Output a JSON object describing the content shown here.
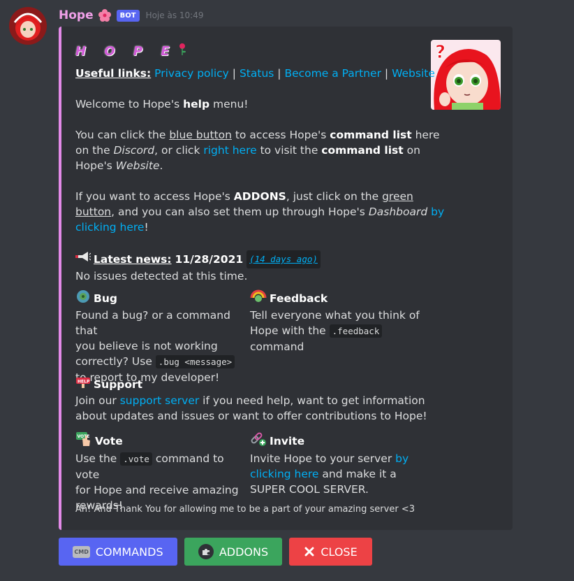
{
  "message": {
    "username": "Hope",
    "bot_tag": "BOT",
    "timestamp": "Hoje às 10:49"
  },
  "embed": {
    "title": "H O P E",
    "accent_color": "#e38ae8",
    "useful_links_label": "Useful links:",
    "links": [
      "Privacy policy",
      "Status",
      "Become a Partner",
      "Website"
    ],
    "separator": "|",
    "welcome_pre": "Welcome to Hope's ",
    "welcome_bold": "help",
    "welcome_post": " menu!",
    "p2_a": "You can click the ",
    "p2_blue_button": "blue button",
    "p2_b": " to access Hope's ",
    "p2_command_list": "command list",
    "p2_c": " here",
    "p2_d": "on the ",
    "p2_discord": "Discord",
    "p2_e": ", or click ",
    "p2_right_here": "right here",
    "p2_f": " to visit the ",
    "p2_command_list2": "command list",
    "p2_g": " on",
    "p2_h": "Hope's ",
    "p2_website": "Website",
    "p2_i": ".",
    "p3_a": "If you want to access Hope's ",
    "p3_addons": "ADDONS",
    "p3_b": ", just click on the ",
    "p3_green": "green",
    "p3_button": "button",
    "p3_c": ", and you can also set them up through Hope's ",
    "p3_dashboard": "Dashboard",
    "p3_by": " by",
    "p3_clicking_here": "clicking here",
    "p3_d": "!",
    "news_label": "Latest news:",
    "news_date": "11/28/2021",
    "news_ago": "(14 days ago)",
    "news_text": "No issues detected at this time.",
    "fields": {
      "bug": {
        "name": "Bug",
        "line1": "Found a bug? or a command that",
        "line2": "you believe is not working",
        "line3_pre": "correctly? Use ",
        "line3_code": ".bug <message>",
        "line4": "to report to my developer!"
      },
      "feedback": {
        "name": "Feedback",
        "line1": "Tell everyone what you think of",
        "line2_pre": "Hope with the ",
        "line2_code": ".feedback",
        "line3": "command"
      },
      "support": {
        "name": "Support",
        "pre": "Join our ",
        "link": "support server",
        "post": " if you need help, want to get information",
        "line2": "about updates and issues or want to offer contributions to Hope!"
      },
      "vote": {
        "name": "Vote",
        "line1_pre": "Use the ",
        "line1_code": ".vote",
        "line1_post": " command to vote",
        "line2": "for Hope and receive amazing",
        "line3": "rewards!"
      },
      "invite": {
        "name": "Invite",
        "line1_pre": "Invite Hope to your server ",
        "line1_link": "by",
        "line2_link": "clicking here",
        "line2_post": " and make it a",
        "line3": "SUPER COOL SERVER."
      }
    },
    "footer": "Ah! And Thank You for allowing me to be a part of your amazing server <3"
  },
  "buttons": {
    "commands": {
      "label": "COMMANDS",
      "icon_text": "CMD",
      "color": "#5865f2"
    },
    "addons": {
      "label": "ADDONS",
      "color": "#3ba55d"
    },
    "close": {
      "label": "CLOSE",
      "color": "#ed4245"
    }
  }
}
